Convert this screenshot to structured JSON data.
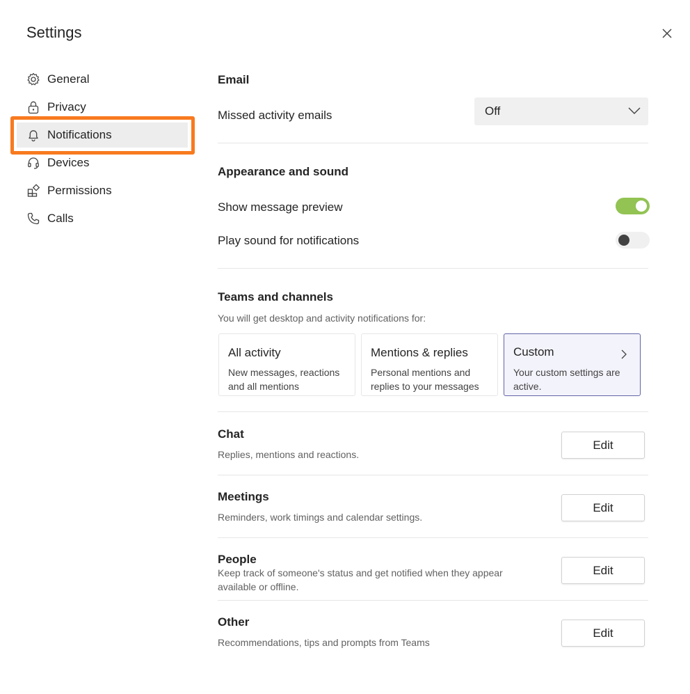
{
  "window": {
    "title": "Settings",
    "close_icon": "close-icon"
  },
  "sidebar": {
    "items": [
      {
        "label": "General",
        "icon": "gear-icon",
        "active": false
      },
      {
        "label": "Privacy",
        "icon": "lock-icon",
        "active": false
      },
      {
        "label": "Notifications",
        "icon": "bell-icon",
        "active": true
      },
      {
        "label": "Devices",
        "icon": "headset-icon",
        "active": false
      },
      {
        "label": "Permissions",
        "icon": "apps-icon",
        "active": false
      },
      {
        "label": "Calls",
        "icon": "phone-icon",
        "active": false
      }
    ],
    "highlight_color": "#f87a1f"
  },
  "email": {
    "heading": "Email",
    "missed_label": "Missed activity emails",
    "missed_value": "Off"
  },
  "appearance": {
    "heading": "Appearance and sound",
    "preview_label": "Show message preview",
    "preview_on": true,
    "sound_label": "Play sound for notifications",
    "sound_on": false,
    "toggle_on_color": "#92c353"
  },
  "teams": {
    "heading": "Teams and channels",
    "description": "You will get desktop and activity notifications for:",
    "options": [
      {
        "title": "All activity",
        "line1": "New messages, reactions",
        "line2": "and all mentions",
        "selected": false
      },
      {
        "title": "Mentions & replies",
        "line1": "Personal mentions and",
        "line2": "replies to your messages",
        "selected": false
      },
      {
        "title": "Custom",
        "line1": "Your custom settings are",
        "line2": "active.",
        "selected": true
      }
    ],
    "selected_border_color": "#6264a7"
  },
  "sections": [
    {
      "title": "Chat",
      "description": "Replies, mentions and reactions.",
      "button": "Edit"
    },
    {
      "title": "Meetings",
      "description": "Reminders, work timings and calendar settings.",
      "button": "Edit"
    },
    {
      "title": "People",
      "line1": "Keep track of someone's status and get notified when they appear",
      "line2": "available or offline.",
      "button": "Edit"
    },
    {
      "title": "Other",
      "description": "Recommendations, tips and prompts from Teams",
      "button": "Edit"
    }
  ]
}
